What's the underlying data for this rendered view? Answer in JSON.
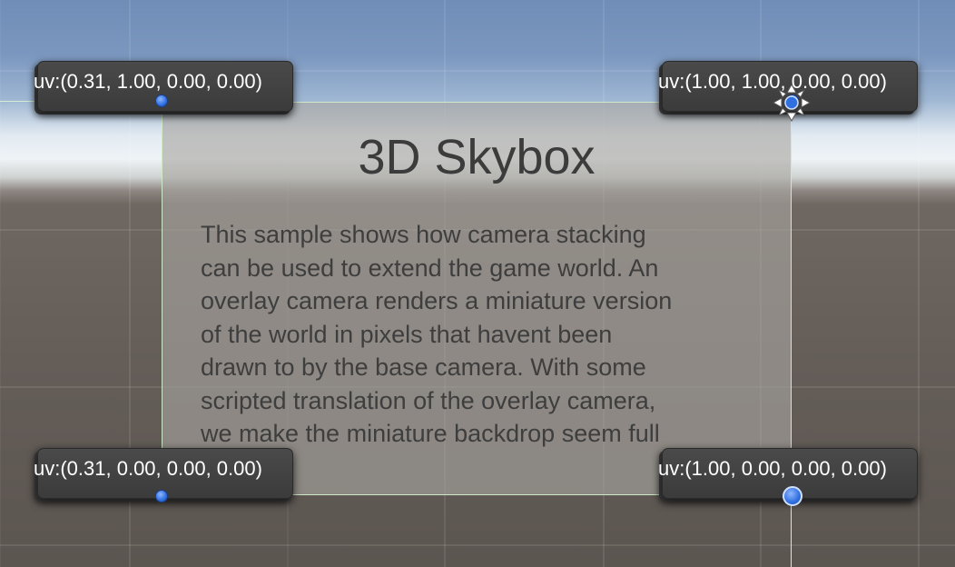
{
  "panel": {
    "title": "3D Skybox",
    "body": "This sample shows how camera stacking\ncan be used to extend the game world. An\noverlay camera renders a miniature version\nof the world in pixels that havent been\ndrawn to by the base camera. With some\nscripted translation of the overlay camera,\nwe make the miniature backdrop seem full"
  },
  "uv_labels": {
    "top_left": "uv:(0.31, 1.00, 0.00, 0.00)",
    "top_right": "uv:(1.00, 1.00, 0.00, 0.00)",
    "bottom_left": "uv:(0.31, 0.00, 0.00, 0.00)",
    "bottom_right": "uv:(1.00, 0.00, 0.00, 0.00)"
  },
  "colors": {
    "handle": "#2f6fe0",
    "label_bg": "#3b3b3b",
    "outline": "#cfe8c8"
  },
  "icons": {
    "handle": "rect-corner-handle-icon",
    "pivot": "pivot-icon"
  }
}
